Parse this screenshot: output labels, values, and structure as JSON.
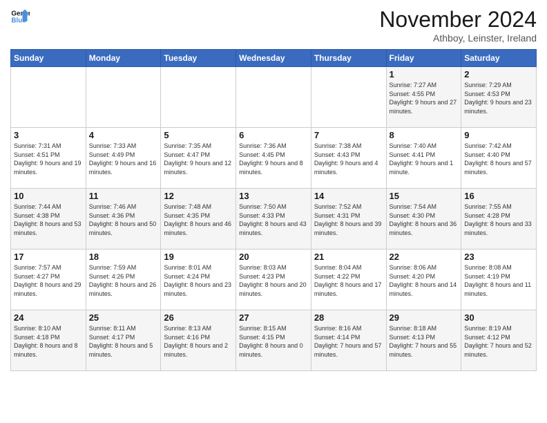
{
  "header": {
    "logo_line1": "General",
    "logo_line2": "Blue",
    "month": "November 2024",
    "location": "Athboy, Leinster, Ireland"
  },
  "days_of_week": [
    "Sunday",
    "Monday",
    "Tuesday",
    "Wednesday",
    "Thursday",
    "Friday",
    "Saturday"
  ],
  "weeks": [
    [
      {
        "day": "",
        "sunrise": "",
        "sunset": "",
        "daylight": ""
      },
      {
        "day": "",
        "sunrise": "",
        "sunset": "",
        "daylight": ""
      },
      {
        "day": "",
        "sunrise": "",
        "sunset": "",
        "daylight": ""
      },
      {
        "day": "",
        "sunrise": "",
        "sunset": "",
        "daylight": ""
      },
      {
        "day": "",
        "sunrise": "",
        "sunset": "",
        "daylight": ""
      },
      {
        "day": "1",
        "sunrise": "Sunrise: 7:27 AM",
        "sunset": "Sunset: 4:55 PM",
        "daylight": "Daylight: 9 hours and 27 minutes."
      },
      {
        "day": "2",
        "sunrise": "Sunrise: 7:29 AM",
        "sunset": "Sunset: 4:53 PM",
        "daylight": "Daylight: 9 hours and 23 minutes."
      }
    ],
    [
      {
        "day": "3",
        "sunrise": "Sunrise: 7:31 AM",
        "sunset": "Sunset: 4:51 PM",
        "daylight": "Daylight: 9 hours and 19 minutes."
      },
      {
        "day": "4",
        "sunrise": "Sunrise: 7:33 AM",
        "sunset": "Sunset: 4:49 PM",
        "daylight": "Daylight: 9 hours and 16 minutes."
      },
      {
        "day": "5",
        "sunrise": "Sunrise: 7:35 AM",
        "sunset": "Sunset: 4:47 PM",
        "daylight": "Daylight: 9 hours and 12 minutes."
      },
      {
        "day": "6",
        "sunrise": "Sunrise: 7:36 AM",
        "sunset": "Sunset: 4:45 PM",
        "daylight": "Daylight: 9 hours and 8 minutes."
      },
      {
        "day": "7",
        "sunrise": "Sunrise: 7:38 AM",
        "sunset": "Sunset: 4:43 PM",
        "daylight": "Daylight: 9 hours and 4 minutes."
      },
      {
        "day": "8",
        "sunrise": "Sunrise: 7:40 AM",
        "sunset": "Sunset: 4:41 PM",
        "daylight": "Daylight: 9 hours and 1 minute."
      },
      {
        "day": "9",
        "sunrise": "Sunrise: 7:42 AM",
        "sunset": "Sunset: 4:40 PM",
        "daylight": "Daylight: 8 hours and 57 minutes."
      }
    ],
    [
      {
        "day": "10",
        "sunrise": "Sunrise: 7:44 AM",
        "sunset": "Sunset: 4:38 PM",
        "daylight": "Daylight: 8 hours and 53 minutes."
      },
      {
        "day": "11",
        "sunrise": "Sunrise: 7:46 AM",
        "sunset": "Sunset: 4:36 PM",
        "daylight": "Daylight: 8 hours and 50 minutes."
      },
      {
        "day": "12",
        "sunrise": "Sunrise: 7:48 AM",
        "sunset": "Sunset: 4:35 PM",
        "daylight": "Daylight: 8 hours and 46 minutes."
      },
      {
        "day": "13",
        "sunrise": "Sunrise: 7:50 AM",
        "sunset": "Sunset: 4:33 PM",
        "daylight": "Daylight: 8 hours and 43 minutes."
      },
      {
        "day": "14",
        "sunrise": "Sunrise: 7:52 AM",
        "sunset": "Sunset: 4:31 PM",
        "daylight": "Daylight: 8 hours and 39 minutes."
      },
      {
        "day": "15",
        "sunrise": "Sunrise: 7:54 AM",
        "sunset": "Sunset: 4:30 PM",
        "daylight": "Daylight: 8 hours and 36 minutes."
      },
      {
        "day": "16",
        "sunrise": "Sunrise: 7:55 AM",
        "sunset": "Sunset: 4:28 PM",
        "daylight": "Daylight: 8 hours and 33 minutes."
      }
    ],
    [
      {
        "day": "17",
        "sunrise": "Sunrise: 7:57 AM",
        "sunset": "Sunset: 4:27 PM",
        "daylight": "Daylight: 8 hours and 29 minutes."
      },
      {
        "day": "18",
        "sunrise": "Sunrise: 7:59 AM",
        "sunset": "Sunset: 4:26 PM",
        "daylight": "Daylight: 8 hours and 26 minutes."
      },
      {
        "day": "19",
        "sunrise": "Sunrise: 8:01 AM",
        "sunset": "Sunset: 4:24 PM",
        "daylight": "Daylight: 8 hours and 23 minutes."
      },
      {
        "day": "20",
        "sunrise": "Sunrise: 8:03 AM",
        "sunset": "Sunset: 4:23 PM",
        "daylight": "Daylight: 8 hours and 20 minutes."
      },
      {
        "day": "21",
        "sunrise": "Sunrise: 8:04 AM",
        "sunset": "Sunset: 4:22 PM",
        "daylight": "Daylight: 8 hours and 17 minutes."
      },
      {
        "day": "22",
        "sunrise": "Sunrise: 8:06 AM",
        "sunset": "Sunset: 4:20 PM",
        "daylight": "Daylight: 8 hours and 14 minutes."
      },
      {
        "day": "23",
        "sunrise": "Sunrise: 8:08 AM",
        "sunset": "Sunset: 4:19 PM",
        "daylight": "Daylight: 8 hours and 11 minutes."
      }
    ],
    [
      {
        "day": "24",
        "sunrise": "Sunrise: 8:10 AM",
        "sunset": "Sunset: 4:18 PM",
        "daylight": "Daylight: 8 hours and 8 minutes."
      },
      {
        "day": "25",
        "sunrise": "Sunrise: 8:11 AM",
        "sunset": "Sunset: 4:17 PM",
        "daylight": "Daylight: 8 hours and 5 minutes."
      },
      {
        "day": "26",
        "sunrise": "Sunrise: 8:13 AM",
        "sunset": "Sunset: 4:16 PM",
        "daylight": "Daylight: 8 hours and 2 minutes."
      },
      {
        "day": "27",
        "sunrise": "Sunrise: 8:15 AM",
        "sunset": "Sunset: 4:15 PM",
        "daylight": "Daylight: 8 hours and 0 minutes."
      },
      {
        "day": "28",
        "sunrise": "Sunrise: 8:16 AM",
        "sunset": "Sunset: 4:14 PM",
        "daylight": "Daylight: 7 hours and 57 minutes."
      },
      {
        "day": "29",
        "sunrise": "Sunrise: 8:18 AM",
        "sunset": "Sunset: 4:13 PM",
        "daylight": "Daylight: 7 hours and 55 minutes."
      },
      {
        "day": "30",
        "sunrise": "Sunrise: 8:19 AM",
        "sunset": "Sunset: 4:12 PM",
        "daylight": "Daylight: 7 hours and 52 minutes."
      }
    ]
  ]
}
